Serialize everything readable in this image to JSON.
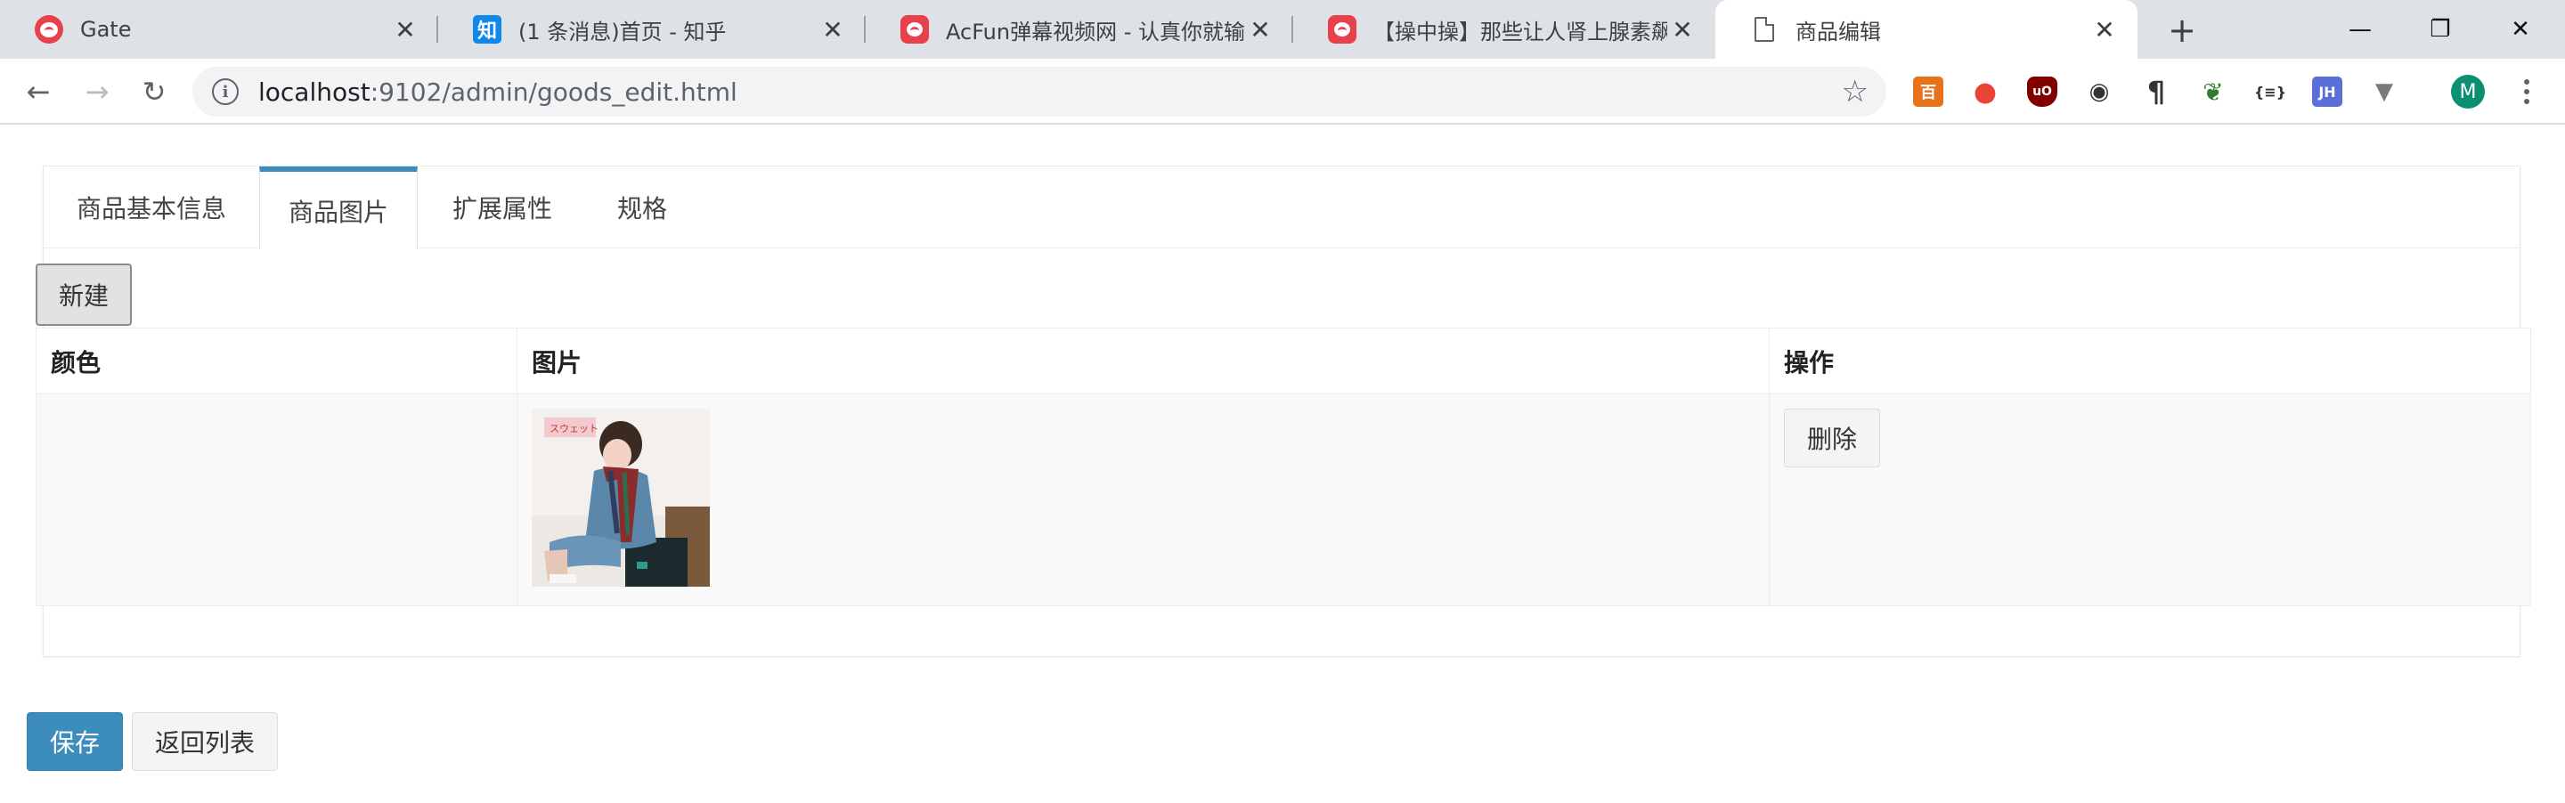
{
  "browser": {
    "tabs": [
      {
        "title": "Gate",
        "icon": "acfun-face-icon"
      },
      {
        "title": "(1 条消息)首页 - 知乎",
        "icon": "zhihu-icon",
        "icon_text": "知"
      },
      {
        "title": "AcFun弹幕视频网 - 认真你就输啦",
        "icon": "acfun-face-icon"
      },
      {
        "title": "【操中操】那些让人肾上腺素飙升",
        "icon": "acfun-face-icon"
      },
      {
        "title": "商品编辑",
        "icon": "document-icon",
        "active": true
      }
    ],
    "newtab_label": "+",
    "window_controls": {
      "minimize": "—",
      "restore": "❐",
      "close": "✕"
    },
    "nav": {
      "back": "←",
      "forward": "→",
      "reload": "↻"
    },
    "address": {
      "host": "localhost",
      "rest": ":9102/admin/goods_edit.html",
      "info": "i",
      "star": "☆"
    },
    "extensions": [
      {
        "name": "ext-baidu-icon",
        "glyph": "百",
        "color": "#e8711c"
      },
      {
        "name": "ext-map-pin-icon",
        "glyph": "●",
        "color": "#ea4335"
      },
      {
        "name": "ext-ublock-icon",
        "glyph": "uO",
        "color": "#800000"
      },
      {
        "name": "ext-spy-icon",
        "glyph": "◉",
        "color": "#333333"
      },
      {
        "name": "ext-pilcrow-icon",
        "glyph": "¶",
        "color": "#333333"
      },
      {
        "name": "ext-leaf-icon",
        "glyph": "❦",
        "color": "#2e7d32"
      },
      {
        "name": "ext-json-icon",
        "glyph": "{≡}",
        "color": "#333333"
      },
      {
        "name": "ext-jh-icon",
        "glyph": "JH",
        "color": "#5b6fd8"
      },
      {
        "name": "ext-vue-icon",
        "glyph": "▼",
        "color": "#7a7a7a"
      }
    ],
    "profile_initial": "M",
    "accent": "#0b8f72"
  },
  "page": {
    "tabs": [
      {
        "label": "商品基本信息",
        "active": false
      },
      {
        "label": "商品图片",
        "active": true
      },
      {
        "label": "扩展属性",
        "active": false
      },
      {
        "label": "规格",
        "active": false
      }
    ],
    "new_button": "新建",
    "table": {
      "headers": [
        "颜色",
        "图片",
        "操作"
      ],
      "rows": [
        {
          "color": "",
          "image_caption": "スウェット",
          "action": "删除"
        }
      ]
    },
    "save_button": "保存",
    "back_button": "返回列表",
    "primary_color": "#3c8dbc"
  }
}
